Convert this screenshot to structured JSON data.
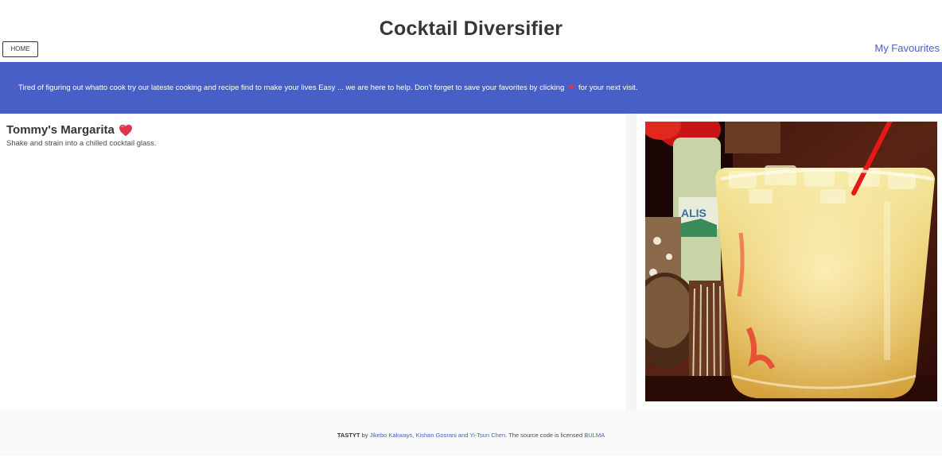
{
  "header": {
    "title": "Cocktail Diversifier",
    "home_label": "HOME",
    "favourites_label": "My Favourites"
  },
  "banner": {
    "text_before": "Tired of figuring out whatto cook try our lateste cooking and recipe find to make your lives Easy ... we are here to help. Don't forget to save your favorites by clicking",
    "heart": "❤",
    "text_after": "for your next visit."
  },
  "recipe": {
    "name": "Tommy's Margarita",
    "instructions": "Shake and strain into a chilled cocktail glass.",
    "favorite_icon": "heart-icon"
  },
  "footer": {
    "brand": "TASTYT",
    "by": "by",
    "authors": "Jikebo Kakways, Kishan Gosrani and Yi-Tsun Chen",
    "license_text": ". The source code is licensed",
    "license_link": "BULMA"
  },
  "colors": {
    "primary": "#485fc7",
    "heart": "#e0364a",
    "text": "#363636"
  }
}
